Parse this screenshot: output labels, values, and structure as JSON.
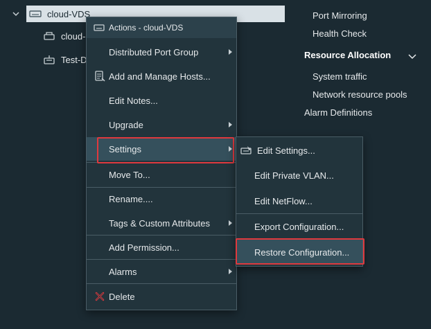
{
  "tree": {
    "root": {
      "label": "cloud-VDS"
    },
    "children": [
      {
        "label": "cloud-"
      },
      {
        "label": "Test-D"
      }
    ]
  },
  "nav": {
    "items": [
      {
        "label": "Port Mirroring"
      },
      {
        "label": "Health Check"
      }
    ],
    "section": {
      "label": "Resource Allocation"
    },
    "section_items": [
      {
        "label": "System traffic"
      },
      {
        "label": "Network resource pools"
      }
    ],
    "bottom": {
      "label": "Alarm Definitions"
    }
  },
  "actions_menu": {
    "header": "Actions - cloud-VDS",
    "items": [
      {
        "label": "Distributed Port Group"
      },
      {
        "label": "Add and Manage Hosts..."
      },
      {
        "label": "Edit Notes..."
      },
      {
        "label": "Upgrade"
      },
      {
        "label": "Settings"
      },
      {
        "label": "Move To..."
      },
      {
        "label": "Rename...."
      },
      {
        "label": "Tags & Custom Attributes"
      },
      {
        "label": "Add Permission..."
      },
      {
        "label": "Alarms"
      },
      {
        "label": "Delete"
      }
    ]
  },
  "settings_menu": {
    "items": [
      {
        "label": "Edit Settings..."
      },
      {
        "label": "Edit Private VLAN..."
      },
      {
        "label": "Edit NetFlow..."
      },
      {
        "label": "Export Configuration..."
      },
      {
        "label": "Restore Configuration..."
      }
    ]
  },
  "colors": {
    "background": "#1b2a32",
    "menu": "#22343c",
    "highlight": "#e0393e",
    "delete": "#e0393e"
  }
}
